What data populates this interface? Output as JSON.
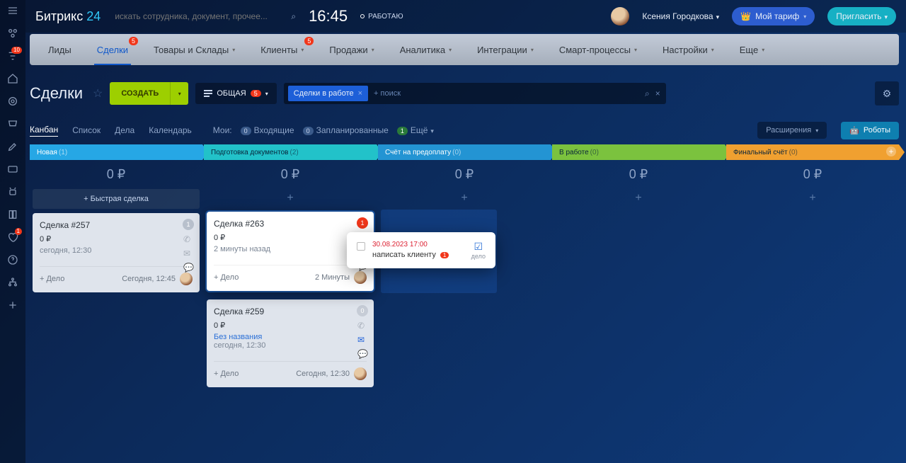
{
  "logo": {
    "p1": "Битрикс",
    "p2": "24"
  },
  "search_placeholder": "искать сотрудника, документ, прочее...",
  "clock": "16:45",
  "work_status": "РАБОТАЮ",
  "user_name": "Ксения Городкова",
  "tariff_btn": "Мой тариф",
  "invite_btn": "Пригласить",
  "rail_badges": {
    "filter": "10",
    "heart": "1"
  },
  "nav": [
    {
      "label": "Лиды"
    },
    {
      "label": "Сделки",
      "badge": "5",
      "active": true
    },
    {
      "label": "Товары и Склады",
      "dd": true
    },
    {
      "label": "Клиенты",
      "dd": true,
      "badge": "5"
    },
    {
      "label": "Продажи",
      "dd": true
    },
    {
      "label": "Аналитика",
      "dd": true
    },
    {
      "label": "Интеграции",
      "dd": true
    },
    {
      "label": "Смарт-процессы",
      "dd": true
    },
    {
      "label": "Настройки",
      "dd": true
    },
    {
      "label": "Еще",
      "dd": true
    }
  ],
  "page_title": "Сделки",
  "create_btn": "СОЗДАТЬ",
  "filter_general": "ОБЩАЯ",
  "filter_general_count": "5",
  "filter_chip": "Сделки в работе",
  "filter_ph": "+ поиск",
  "views": {
    "tabs": [
      "Канбан",
      "Список",
      "Дела",
      "Календарь"
    ],
    "mine_label": "Мои:",
    "incoming": {
      "n": "0",
      "t": "Входящие"
    },
    "planned": {
      "n": "0",
      "t": "Запланированные"
    },
    "more": {
      "n": "1",
      "t": "Ещё"
    },
    "ext_btn": "Расширения",
    "robots_btn": "Роботы"
  },
  "columns": [
    {
      "title": "Новая",
      "count": "(1)",
      "sum": "0 ₽",
      "quick": "Быстрая сделка"
    },
    {
      "title": "Подготовка документов",
      "count": "(2)",
      "sum": "0 ₽"
    },
    {
      "title": "Счёт на предоплату",
      "count": "(0)",
      "sum": "0 ₽"
    },
    {
      "title": "В работе",
      "count": "(0)",
      "sum": "0 ₽"
    },
    {
      "title": "Финальный счёт",
      "count": "(0)",
      "sum": "0 ₽"
    }
  ],
  "cards": {
    "c257": {
      "title": "Сделка #257",
      "amount": "0 ₽",
      "when": "сегодня, 12:30",
      "badge": "1",
      "add": "+ Дело",
      "ftr_time": "Сегодня, 12:45"
    },
    "c263": {
      "title": "Сделка #263",
      "amount": "0 ₽",
      "when": "2 минуты назад",
      "badge": "1",
      "add": "+ Дело",
      "ftr_time": "2 Минуты"
    },
    "c259": {
      "title": "Сделка #259",
      "amount": "0 ₽",
      "link": "Без названия",
      "when": "сегодня, 12:30",
      "badge": "0",
      "add": "+ Дело",
      "ftr_time": "Сегодня, 12:30"
    }
  },
  "popover": {
    "date": "30.08.2023 17:00",
    "task": "написать клиенту",
    "task_badge": "1",
    "action": "дело"
  },
  "plus": "+",
  "plus_prefix": "+  "
}
